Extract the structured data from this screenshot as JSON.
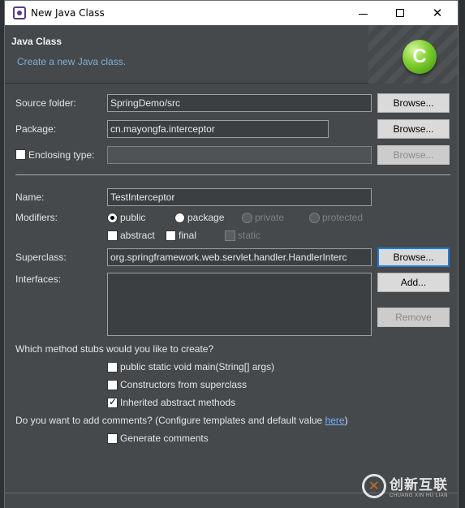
{
  "window": {
    "title": "New Java Class",
    "controls": {
      "minimize": "",
      "maximize": "",
      "close": "✕"
    }
  },
  "banner": {
    "title": "Java Class",
    "description": "Create a new Java class.",
    "icon_letter": "C"
  },
  "source_folder": {
    "label": "Source folder:",
    "value": "SpringDemo/src",
    "browse": "Browse..."
  },
  "package": {
    "label": "Package:",
    "value": "cn.mayongfa.interceptor",
    "browse": "Browse..."
  },
  "enclosing_type": {
    "label": "Enclosing type:",
    "value": "",
    "checked": false,
    "browse": "Browse..."
  },
  "name": {
    "label": "Name:",
    "value": "TestInterceptor"
  },
  "modifiers": {
    "label": "Modifiers:",
    "visibility": [
      {
        "label": "public",
        "checked": true,
        "enabled": true
      },
      {
        "label": "package",
        "checked": false,
        "enabled": true
      },
      {
        "label": "private",
        "checked": false,
        "enabled": false
      },
      {
        "label": "protected",
        "checked": false,
        "enabled": false
      }
    ],
    "flags": [
      {
        "label": "abstract",
        "checked": false,
        "enabled": true
      },
      {
        "label": "final",
        "checked": false,
        "enabled": true
      },
      {
        "label": "static",
        "checked": false,
        "enabled": false
      }
    ]
  },
  "superclass": {
    "label": "Superclass:",
    "value": "org.springframework.web.servlet.handler.HandlerInterc",
    "browse": "Browse..."
  },
  "interfaces": {
    "label": "Interfaces:",
    "add": "Add...",
    "remove": "Remove"
  },
  "method_stubs": {
    "question": "Which method stubs would you like to create?",
    "options": [
      {
        "label": "public static void main(String[] args)",
        "checked": false
      },
      {
        "label": "Constructors from superclass",
        "checked": false
      },
      {
        "label": "Inherited abstract methods",
        "checked": true
      }
    ]
  },
  "comments": {
    "question_prefix": "Do you want to add comments? (Configure templates and default value ",
    "link": "here",
    "question_suffix": ")",
    "generate": {
      "label": "Generate comments",
      "checked": false
    }
  },
  "watermark": {
    "main": "创新互联",
    "sub": "CHUANG XIN HU LIAN"
  }
}
